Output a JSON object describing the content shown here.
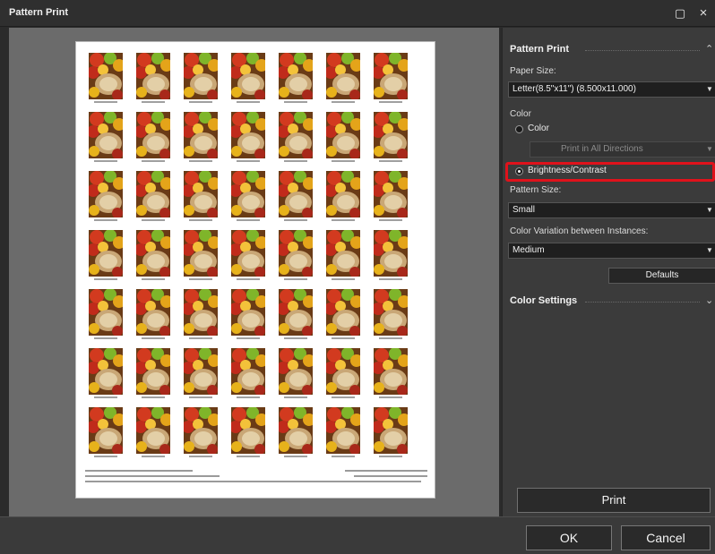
{
  "window": {
    "title": "Pattern Print",
    "maximize_icon": "▢",
    "close_icon": "×"
  },
  "preview": {
    "rows": 7,
    "cols": 7
  },
  "panel": {
    "pattern_print_header": "Pattern Print",
    "paper_size_label": "Paper Size:",
    "paper_size_value": "Letter(8.5\"x11\") (8.500x11.000)",
    "color_label": "Color",
    "color_radio_label": "Color",
    "direction_value": "Print in All Directions",
    "brightness_radio_label": "Brightness/Contrast",
    "pattern_size_label": "Pattern Size:",
    "pattern_size_value": "Small",
    "variation_label": "Color Variation between Instances:",
    "variation_value": "Medium",
    "defaults_button": "Defaults",
    "color_settings_header": "Color Settings",
    "print_button": "Print",
    "dropdown_arrow": "▼",
    "collapse_icon": "⌃",
    "expand_icon": "⌄"
  },
  "footer": {
    "ok_button": "OK",
    "cancel_button": "Cancel"
  },
  "colors": {
    "highlight": "#e0121b",
    "panel_bg": "#3b3b3b",
    "preview_bg": "#6b6b6b"
  }
}
